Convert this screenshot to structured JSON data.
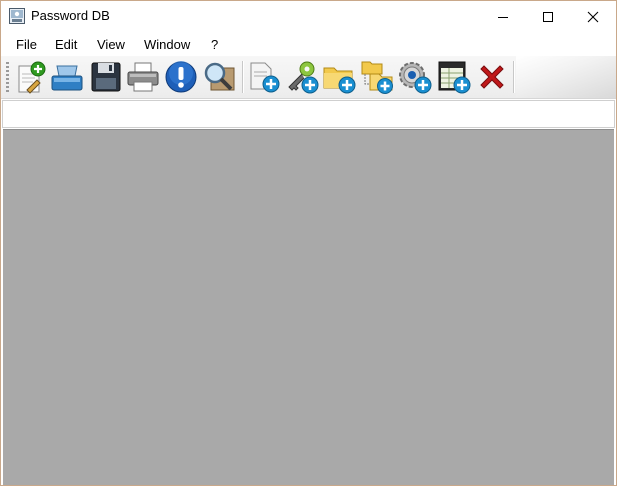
{
  "window": {
    "title": "Password DB"
  },
  "caption_buttons": {
    "minimize": "minimize",
    "maximize": "maximize",
    "close": "close"
  },
  "menu": [
    {
      "label": "File"
    },
    {
      "label": "Edit"
    },
    {
      "label": "View"
    },
    {
      "label": "Window"
    },
    {
      "label": "?"
    }
  ],
  "toolbar": {
    "buttons": [
      {
        "icon": "new-document-icon"
      },
      {
        "icon": "scanner-icon"
      },
      {
        "icon": "save-disk-icon"
      },
      {
        "icon": "printer-icon"
      },
      {
        "icon": "info-icon"
      },
      {
        "icon": "search-magnifier-icon"
      },
      {
        "icon": "add-entry-icon"
      },
      {
        "icon": "add-key-icon"
      },
      {
        "icon": "add-folder-icon"
      },
      {
        "icon": "add-subfolder-icon"
      },
      {
        "icon": "add-settings-icon"
      },
      {
        "icon": "add-table-icon"
      },
      {
        "icon": "delete-icon"
      }
    ]
  },
  "colors": {
    "client_background": "#a9a9a9",
    "accent_blue": "#1a8fd1",
    "accent_green": "#2f9a20",
    "delete_red": "#c0181a"
  }
}
